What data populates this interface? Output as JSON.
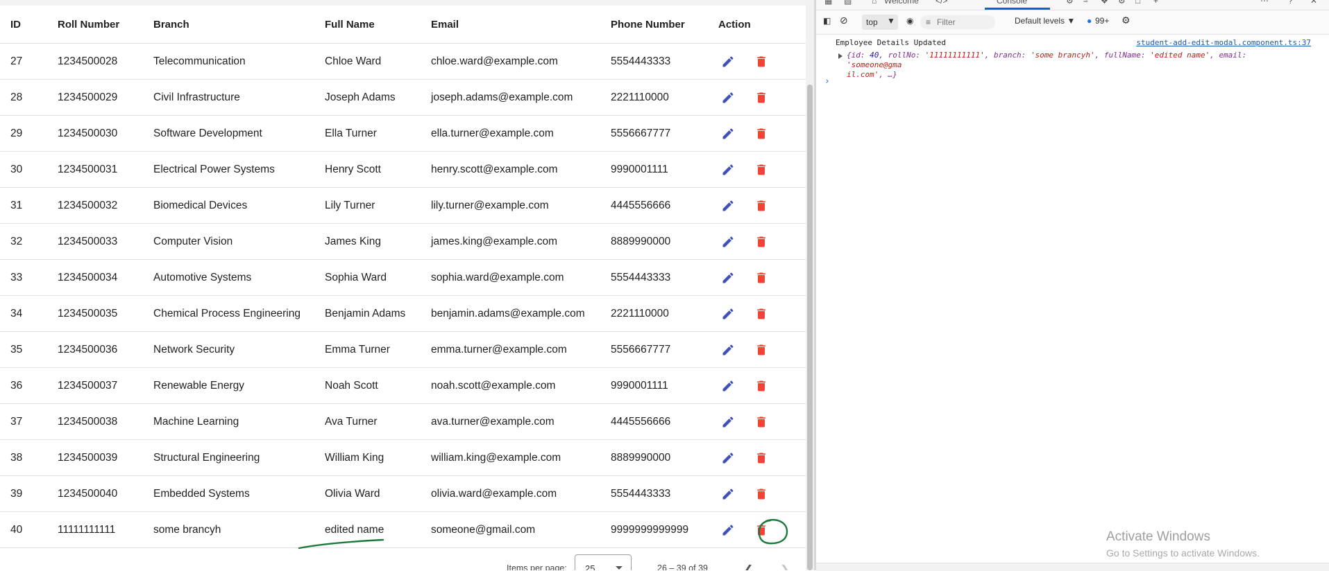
{
  "table": {
    "headers": [
      "ID",
      "Roll Number",
      "Branch",
      "Full Name",
      "Email",
      "Phone Number",
      "Action"
    ],
    "rows": [
      [
        "27",
        "1234500028",
        "Telecommunication",
        "Chloe Ward",
        "chloe.ward@example.com",
        "5554443333"
      ],
      [
        "28",
        "1234500029",
        "Civil Infrastructure",
        "Joseph Adams",
        "joseph.adams@example.com",
        "2221110000"
      ],
      [
        "29",
        "1234500030",
        "Software Development",
        "Ella Turner",
        "ella.turner@example.com",
        "5556667777"
      ],
      [
        "30",
        "1234500031",
        "Electrical Power Systems",
        "Henry Scott",
        "henry.scott@example.com",
        "9990001111"
      ],
      [
        "31",
        "1234500032",
        "Biomedical Devices",
        "Lily Turner",
        "lily.turner@example.com",
        "4445556666"
      ],
      [
        "32",
        "1234500033",
        "Computer Vision",
        "James King",
        "james.king@example.com",
        "8889990000"
      ],
      [
        "33",
        "1234500034",
        "Automotive Systems",
        "Sophia Ward",
        "sophia.ward@example.com",
        "5554443333"
      ],
      [
        "34",
        "1234500035",
        "Chemical Process Engineering",
        "Benjamin Adams",
        "benjamin.adams@example.com",
        "2221110000"
      ],
      [
        "35",
        "1234500036",
        "Network Security",
        "Emma Turner",
        "emma.turner@example.com",
        "5556667777"
      ],
      [
        "36",
        "1234500037",
        "Renewable Energy",
        "Noah Scott",
        "noah.scott@example.com",
        "9990001111"
      ],
      [
        "37",
        "1234500038",
        "Machine Learning",
        "Ava Turner",
        "ava.turner@example.com",
        "4445556666"
      ],
      [
        "38",
        "1234500039",
        "Structural Engineering",
        "William King",
        "william.king@example.com",
        "8889990000"
      ],
      [
        "39",
        "1234500040",
        "Embedded Systems",
        "Olivia Ward",
        "olivia.ward@example.com",
        "5554443333"
      ],
      [
        "40",
        "11111111111",
        "some brancyh",
        "edited name",
        "someone@gmail.com",
        "9999999999999"
      ]
    ],
    "edit_icon": "pencil-icon",
    "delete_icon": "trash-icon",
    "edit_color": "#3f51b5",
    "delete_color": "#f44336"
  },
  "paginator": {
    "items_per_page_label": "Items per page:",
    "page_size": "25",
    "range_label": "26 – 39 of 39"
  },
  "devtools": {
    "tabs": [
      "Welcome",
      "</>",
      "Console"
    ],
    "context": "top",
    "filter_placeholder": "Filter",
    "levels": "Default levels",
    "issues_count": "99+",
    "log_message": "Employee Details Updated",
    "log_source": "student-add-edit-modal.component.ts:37",
    "log_object_line1_parts": [
      "{id: ",
      "40",
      ", rollNo: ",
      "'11111111111'",
      ", branch: ",
      "'some brancyh'",
      ", fullName: ",
      "'edited name'",
      ", email: ",
      "'someone@gma"
    ],
    "log_object_line2_parts": [
      "il.com'",
      ", …}"
    ],
    "prompt": "›"
  },
  "windows_watermark": {
    "title": "Activate Windows",
    "subtitle": "Go to Settings to activate Windows."
  },
  "annotation_color": "#1a7a3c"
}
